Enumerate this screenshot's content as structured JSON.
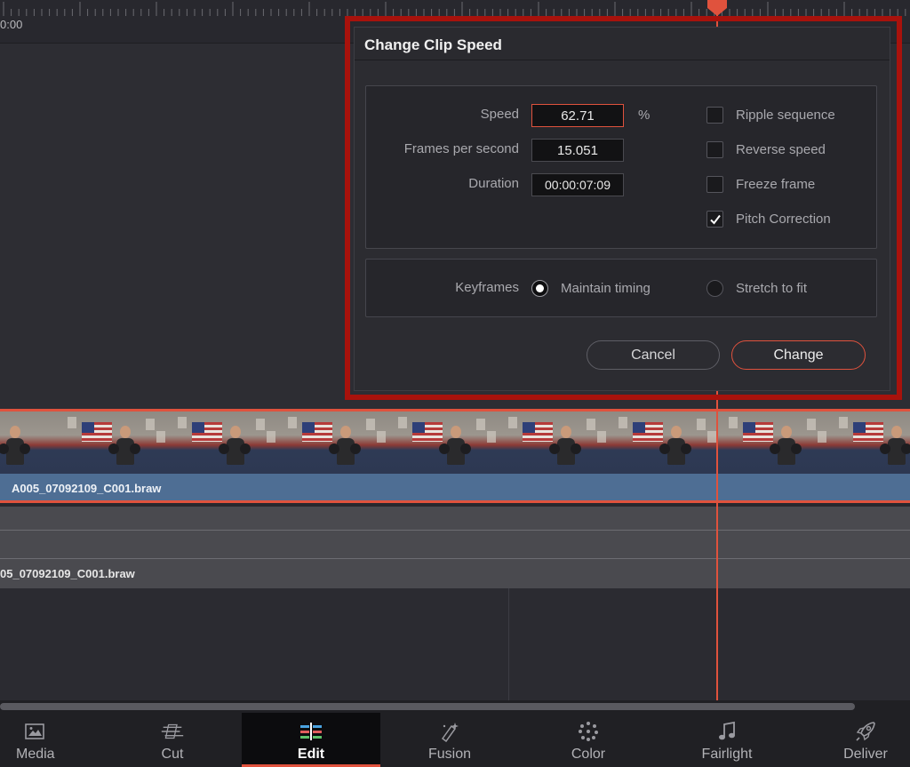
{
  "timeline": {
    "timecode": "0:00",
    "video_clip_name": "A005_07092109_C001.braw",
    "audio_clip_name": "05_07092109_C001.braw"
  },
  "dialog": {
    "title": "Change Clip Speed",
    "fields": {
      "speed_label": "Speed",
      "speed_value": "62.71",
      "speed_unit": "%",
      "fps_label": "Frames per second",
      "fps_value": "15.051",
      "duration_label": "Duration",
      "duration_value": "00:00:07:09"
    },
    "options": {
      "ripple_label": "Ripple sequence",
      "ripple_checked": false,
      "reverse_label": "Reverse speed",
      "reverse_checked": false,
      "freeze_label": "Freeze frame",
      "freeze_checked": false,
      "pitch_label": "Pitch Correction",
      "pitch_checked": true
    },
    "keyframes": {
      "label": "Keyframes",
      "maintain_label": "Maintain timing",
      "stretch_label": "Stretch to fit",
      "selected": "maintain"
    },
    "buttons": {
      "cancel": "Cancel",
      "change": "Change"
    }
  },
  "pages": [
    {
      "label": "Media",
      "icon": "media-icon"
    },
    {
      "label": "Cut",
      "icon": "cut-icon"
    },
    {
      "label": "Edit",
      "icon": "edit-icon",
      "active": true
    },
    {
      "label": "Fusion",
      "icon": "fusion-icon"
    },
    {
      "label": "Color",
      "icon": "color-icon"
    },
    {
      "label": "Fairlight",
      "icon": "fairlight-icon"
    },
    {
      "label": "Deliver",
      "icon": "deliver-icon"
    }
  ],
  "colors": {
    "accent": "#e0523d",
    "highlight_outline": "#a8120c",
    "clip_bar": "#4e6e94"
  }
}
